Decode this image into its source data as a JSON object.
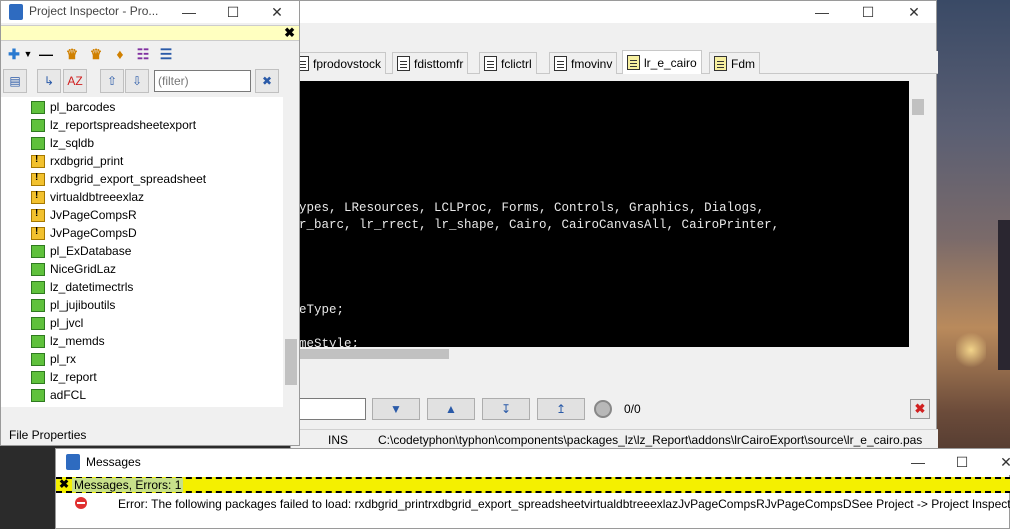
{
  "editor": {
    "tabs": [
      "fprodovstock",
      "fdisttomfr",
      "fclictrl",
      "fmovinv",
      "lr_e_cairo",
      "Fdm"
    ],
    "active_tab": "lr_e_cairo",
    "code_lines": [
      "ypes, LResources, LCLProc, Forms, Controls, Graphics, Dialogs,",
      "r_barc, lr_rrect, lr_shape, Cairo, CairoCanvasAll, CairoPrinter,",
      "eType;",
      "meStyle;"
    ],
    "search_count": "0/0",
    "status_mode": "INS",
    "status_path": "C:\\codetyphon\\typhon\\components\\packages_lz\\lz_Report\\addons\\lrCairoExport\\source\\lr_e_cairo.pas"
  },
  "inspector": {
    "title": "Project Inspector - Pro...",
    "filter_placeholder": "(filter)",
    "footer_label": "File Properties",
    "items": [
      {
        "label": "pl_barcodes",
        "warn": false
      },
      {
        "label": "lz_reportspreadsheetexport",
        "warn": false
      },
      {
        "label": "lz_sqldb",
        "warn": false
      },
      {
        "label": "rxdbgrid_print",
        "warn": true
      },
      {
        "label": "rxdbgrid_export_spreadsheet",
        "warn": true
      },
      {
        "label": "virtualdbtreeexlaz",
        "warn": true
      },
      {
        "label": "JvPageCompsR",
        "warn": true
      },
      {
        "label": "JvPageCompsD",
        "warn": true
      },
      {
        "label": "pl_ExDatabase",
        "warn": false
      },
      {
        "label": "NiceGridLaz",
        "warn": false
      },
      {
        "label": "lz_datetimectrls",
        "warn": false
      },
      {
        "label": "pl_jujiboutils",
        "warn": false
      },
      {
        "label": "pl_jvcl",
        "warn": false
      },
      {
        "label": "lz_memds",
        "warn": false
      },
      {
        "label": "pl_rx",
        "warn": false
      },
      {
        "label": "lz_report",
        "warn": false
      },
      {
        "label": "adFCL",
        "warn": false
      }
    ]
  },
  "messages": {
    "title": "Messages",
    "header": "Messages, Errors: 1",
    "error_text": "Error: The following packages failed to load: rxdbgrid_printrxdbgrid_export_spreadsheetvirtualdbtreeexlazJvPageCompsRJvPageCompsDSee Project -> Project Inspector"
  },
  "colors": {
    "messages_header_bg": "#f4f000",
    "code_bg": "#000000",
    "package_ok": "#5fc13c",
    "package_warn": "#f2c12e"
  }
}
